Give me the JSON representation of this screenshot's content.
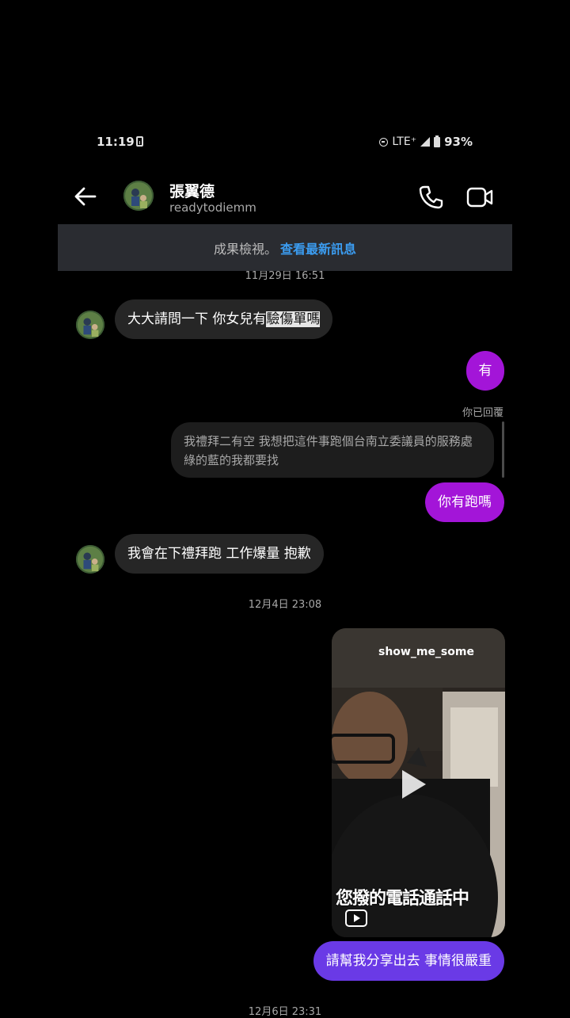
{
  "status_bar": {
    "time": "11:19",
    "network": "LTE⁺",
    "battery": "93%"
  },
  "header": {
    "name": "張翼德",
    "username": "readytodiemm"
  },
  "banner": {
    "text": "成果檢視。",
    "link": "查看最新訊息"
  },
  "timestamps": {
    "t1": "11月29日 16:51",
    "t2": "12月4日 23:08",
    "t3": "12月6日 23:31"
  },
  "messages": {
    "in_1_prefix": "大大請問一下 你女兒有",
    "in_1_highlight": "驗傷單嗎",
    "out_1": "有",
    "reply_label": "你已回覆",
    "reply_quote": "我禮拜二有空 我想把這件事跑個台南立委議員的服務處 綠的藍的我都要找",
    "out_2": "你有跑嗎",
    "in_2": "我會在下禮拜跑 工作爆量 抱歉",
    "shared_video_user": "show_me_some",
    "shared_video_caption": "您撥的電話通話中",
    "out_3": "請幫我分享出去 事情很嚴重"
  },
  "colors": {
    "bubble_in": "#262626",
    "bubble_purple": "#a315d8",
    "bubble_violet": "#6a3ae6",
    "link": "#3b9cf0",
    "banner_bg": "#2a2c31"
  },
  "icons": [
    "back-arrow-icon",
    "phone-icon",
    "video-call-icon",
    "play-icon",
    "reels-icon"
  ]
}
